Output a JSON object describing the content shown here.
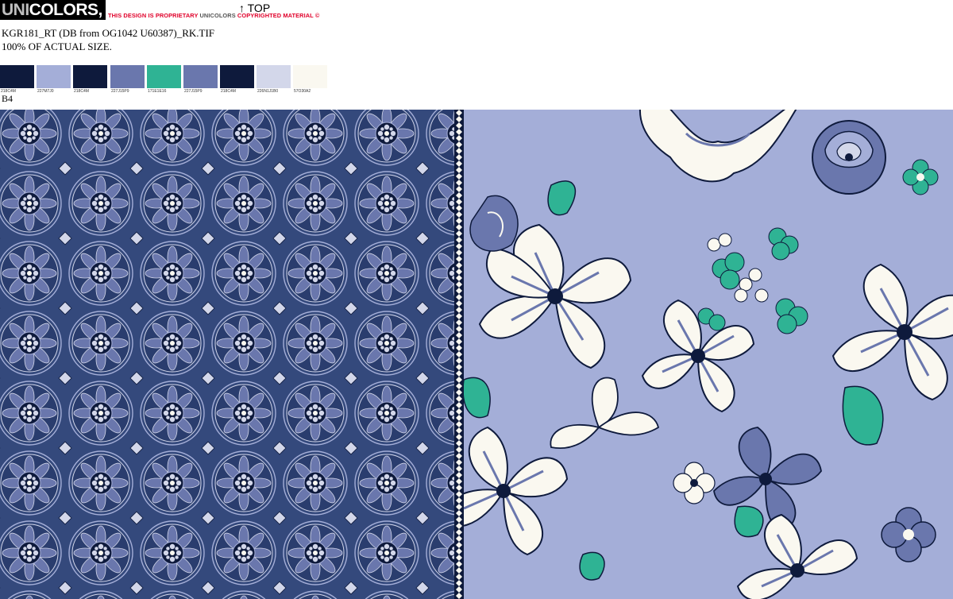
{
  "header": {
    "brand_prefix": "UNI",
    "brand_suffix": "COLORS, INC.",
    "notice": {
      "part1": "THIS DESIGN IS PROPRIETARY",
      "part2": "UNICOLORS",
      "part3": "COPYRIGHTED MATERIAL ©"
    },
    "top_marker": "↑ TOP",
    "filename": "KGR181_RT (DB from OG1042 U60387)_RK.TIF",
    "scale_note": "100% OF ACTUAL SIZE.",
    "variant_label": "B4"
  },
  "swatches": [
    {
      "code": "218C4M",
      "color": "#0e1a3c"
    },
    {
      "code": "227M7J0",
      "color": "#a4aed8"
    },
    {
      "code": "218C4M",
      "color": "#0e1a3c"
    },
    {
      "code": "227J15P9",
      "color": "#6a77ad"
    },
    {
      "code": "171E1E16",
      "color": "#2fb394"
    },
    {
      "code": "227J15P9",
      "color": "#6a77ad"
    },
    {
      "code": "218C4M",
      "color": "#0e1a3c"
    },
    {
      "code": "226N1J1B0",
      "color": "#d3d7ea"
    },
    {
      "code": "57O30A2",
      "color": "#faf8f0"
    }
  ],
  "colors": {
    "navy": "#0e1a3c",
    "periwinkle": "#a4aed8",
    "slate_blue": "#6a77ad",
    "teal": "#2fb394",
    "lavender_light": "#d3d7ea",
    "cream": "#faf8f0",
    "medallion_ground": "#34497c"
  }
}
